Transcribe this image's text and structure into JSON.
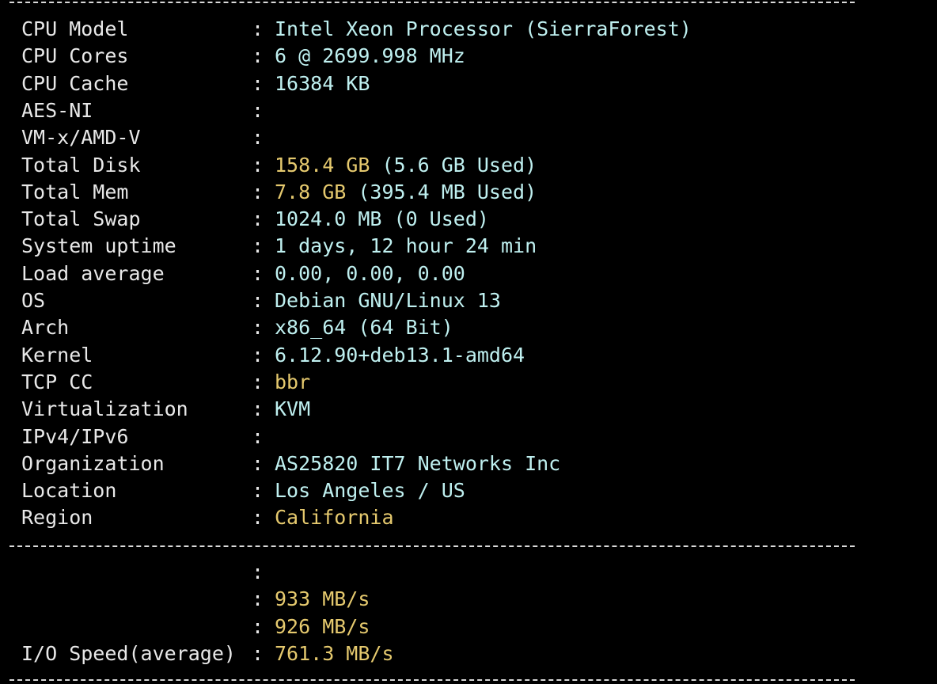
{
  "colors": {
    "background": "#000000",
    "label": "#e8e8e8",
    "value_cyan": "#bff0f0",
    "value_yellow": "#e5c96e"
  },
  "info_rows": [
    {
      "label": "CPU Model",
      "value": "Intel Xeon Processor (SierraForest)",
      "extra": "",
      "color": "cyan"
    },
    {
      "label": "CPU Cores",
      "value": "6 @ 2699.998 MHz",
      "extra": "",
      "color": "cyan"
    },
    {
      "label": "CPU Cache",
      "value": "16384 KB",
      "extra": "",
      "color": "cyan"
    },
    {
      "label": "AES-NI",
      "value": "",
      "extra": "",
      "color": "cyan"
    },
    {
      "label": "VM-x/AMD-V",
      "value": "",
      "extra": "",
      "color": "cyan"
    },
    {
      "label": "Total Disk",
      "value": "158.4 GB",
      "extra": " (5.6 GB Used)",
      "color": "yellow"
    },
    {
      "label": "Total Mem",
      "value": "7.8 GB",
      "extra": " (395.4 MB Used)",
      "color": "yellow"
    },
    {
      "label": "Total Swap",
      "value": "1024.0 MB (0 Used)",
      "extra": "",
      "color": "cyan"
    },
    {
      "label": "System uptime",
      "value": "1 days, 12 hour 24 min",
      "extra": "",
      "color": "cyan"
    },
    {
      "label": "Load average",
      "value": "0.00, 0.00, 0.00",
      "extra": "",
      "color": "cyan"
    },
    {
      "label": "OS",
      "value": "Debian GNU/Linux 13",
      "extra": "",
      "color": "cyan"
    },
    {
      "label": "Arch",
      "value": "x86_64 (64 Bit)",
      "extra": "",
      "color": "cyan"
    },
    {
      "label": "Kernel",
      "value": "6.12.90+deb13.1-amd64",
      "extra": "",
      "color": "cyan"
    },
    {
      "label": "TCP CC",
      "value": "bbr",
      "extra": "",
      "color": "yellow"
    },
    {
      "label": "Virtualization",
      "value": "KVM",
      "extra": "",
      "color": "cyan"
    },
    {
      "label": "IPv4/IPv6",
      "value": "",
      "extra": "",
      "color": "cyan"
    },
    {
      "label": "Organization",
      "value": "AS25820 IT7 Networks Inc",
      "extra": "",
      "color": "cyan"
    },
    {
      "label": "Location",
      "value": "Los Angeles / US",
      "extra": "",
      "color": "cyan"
    },
    {
      "label": "Region",
      "value": "California",
      "extra": "",
      "color": "yellow"
    }
  ],
  "io_rows": [
    {
      "label": "",
      "value": "",
      "extra": "",
      "color": "yellow"
    },
    {
      "label": "",
      "value": "933 MB/s",
      "extra": "",
      "color": "yellow"
    },
    {
      "label": "",
      "value": "926 MB/s",
      "extra": "",
      "color": "yellow"
    },
    {
      "label": "I/O Speed(average)",
      "value": "761.3 MB/s",
      "extra": "",
      "color": "yellow"
    }
  ],
  "separator_char": ":"
}
